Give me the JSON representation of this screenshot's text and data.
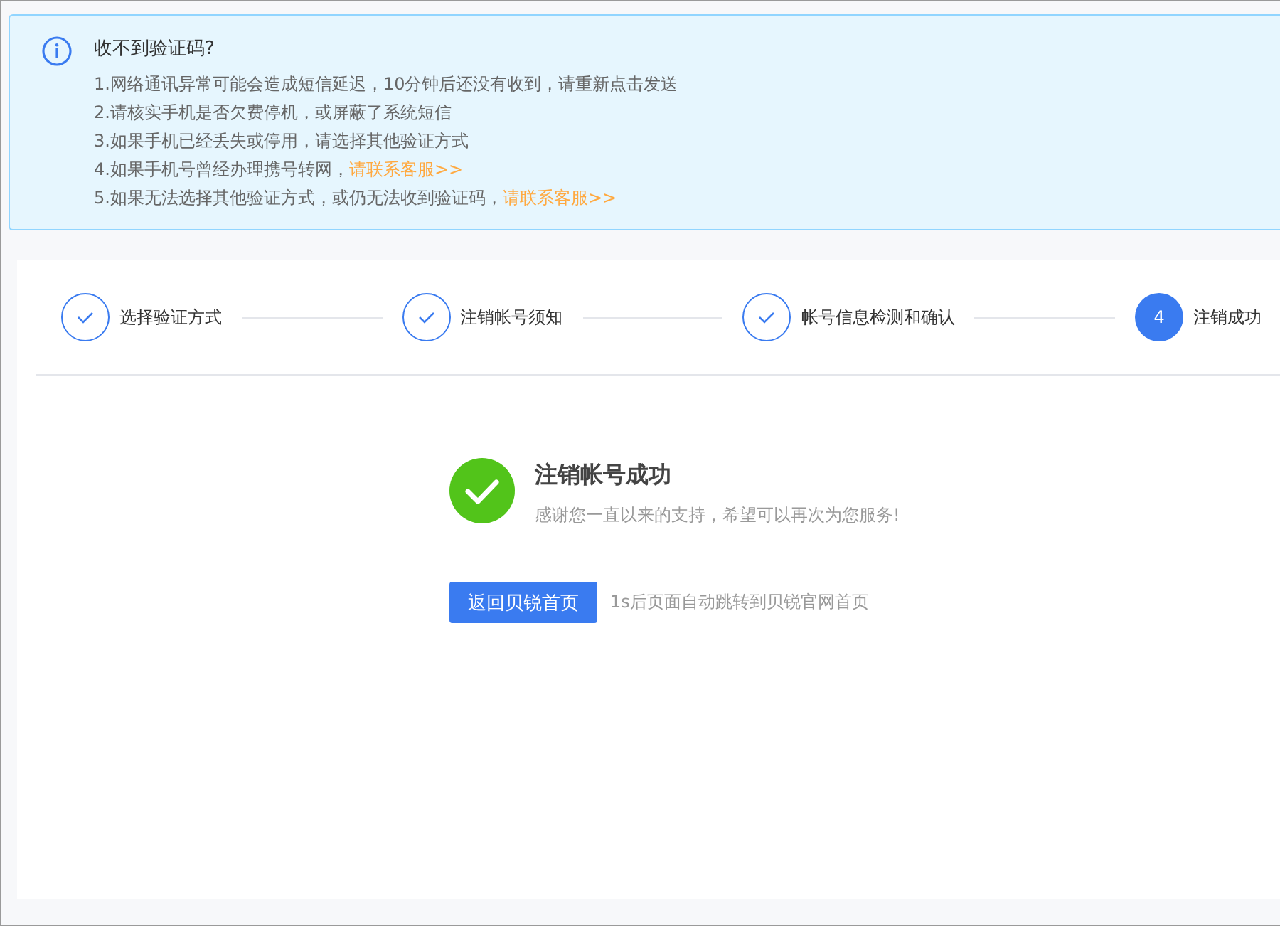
{
  "notice": {
    "title": "收不到验证码?",
    "items": [
      {
        "text": "1.网络通讯异常可能会造成短信延迟，10分钟后还没有收到，请重新点击发送"
      },
      {
        "text": "2.请核实手机是否欠费停机，或屏蔽了系统短信"
      },
      {
        "text": "3.如果手机已经丢失或停用，请选择其他验证方式"
      },
      {
        "text": "4.如果手机号曾经办理携号转网，",
        "link": "请联系客服>>"
      },
      {
        "text": "5.如果无法选择其他验证方式，或仍无法收到验证码，",
        "link": "请联系客服>>"
      }
    ]
  },
  "steps": [
    {
      "label": "选择验证方式",
      "kind": "done"
    },
    {
      "label": "注销帐号须知",
      "kind": "done"
    },
    {
      "label": "帐号信息检测和确认",
      "kind": "done"
    },
    {
      "label": "注销成功",
      "kind": "current",
      "number": "4"
    }
  ],
  "result": {
    "title": "注销帐号成功",
    "subtitle": "感谢您一直以来的支持，希望可以再次为您服务!",
    "button": "返回贝锐首页",
    "redirect_note": "1s后页面自动跳转到贝锐官网首页"
  }
}
